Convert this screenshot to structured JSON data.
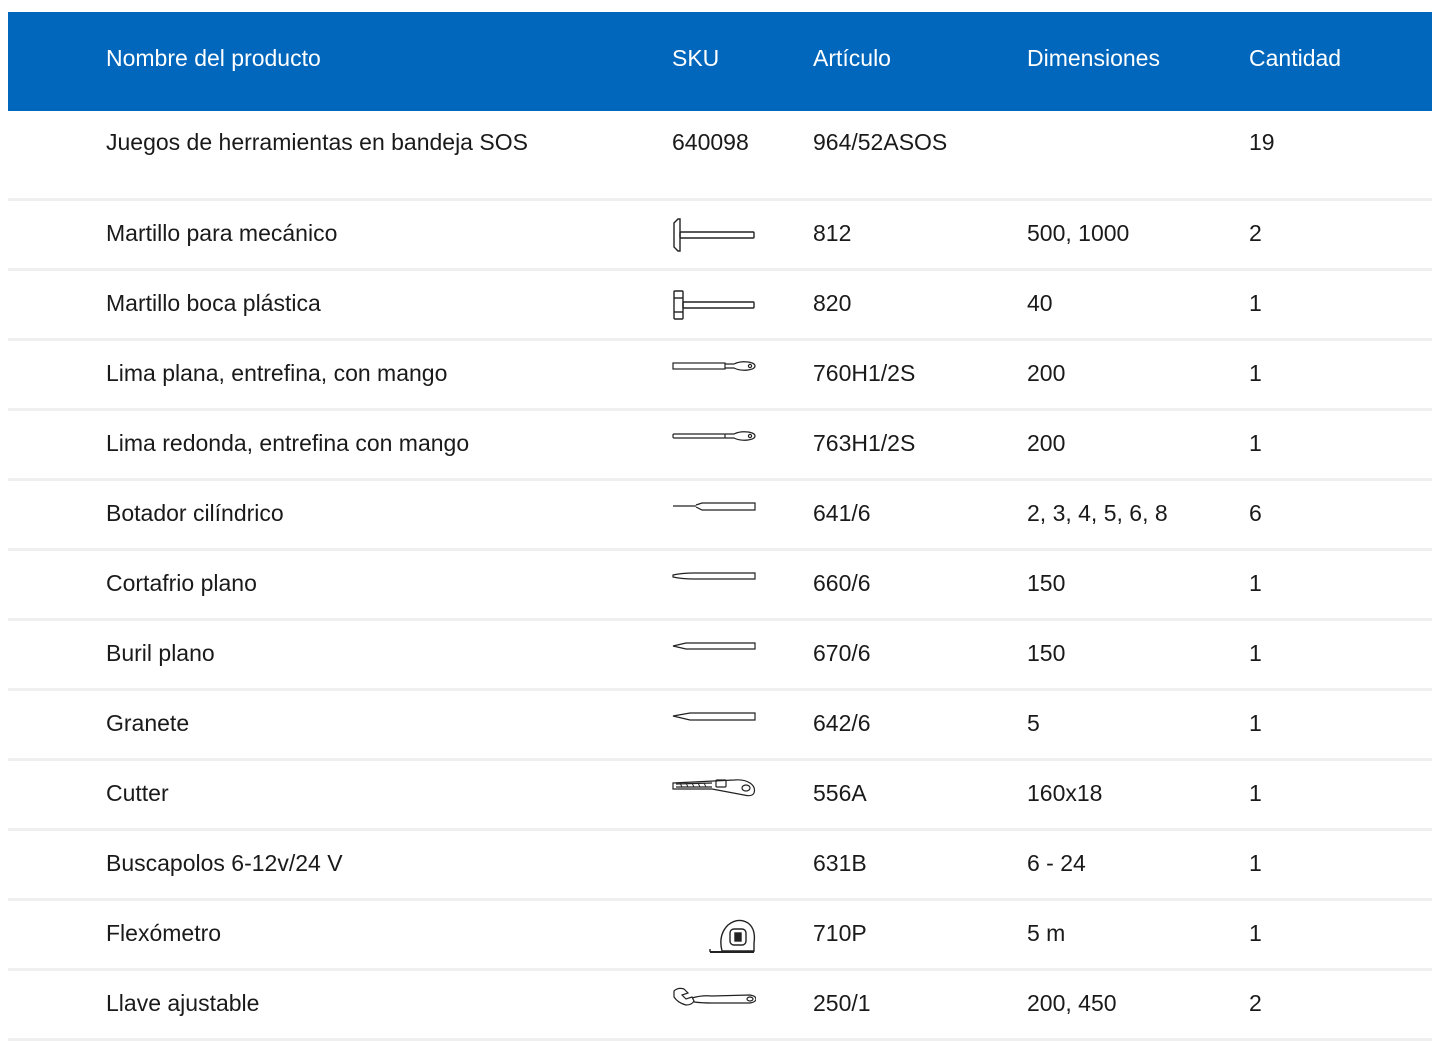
{
  "table": {
    "headers": {
      "name": "Nombre del producto",
      "sku": "SKU",
      "article": "Artículo",
      "dimensions": "Dimensiones",
      "quantity": "Cantidad"
    },
    "rows": [
      {
        "name": "Juegos de herramientas en bandeja SOS",
        "sku": "640098",
        "icon": null,
        "article": "964/52ASOS",
        "dimensions": "",
        "quantity": "19"
      },
      {
        "name": "Martillo para mecánico",
        "sku": "",
        "icon": "machinist-hammer-icon",
        "article": "812",
        "dimensions": "500, 1000",
        "quantity": "2"
      },
      {
        "name": "Martillo boca plástica",
        "sku": "",
        "icon": "plastic-mallet-icon",
        "article": "820",
        "dimensions": "40",
        "quantity": "1"
      },
      {
        "name": "Lima plana, entrefina, con mango",
        "sku": "",
        "icon": "flat-file-icon",
        "article": "760H1/2S",
        "dimensions": "200",
        "quantity": "1"
      },
      {
        "name": "Lima redonda, entrefina con mango",
        "sku": "",
        "icon": "round-file-icon",
        "article": "763H1/2S",
        "dimensions": "200",
        "quantity": "1"
      },
      {
        "name": "Botador cilíndrico",
        "sku": "",
        "icon": "pin-punch-icon",
        "article": "641/6",
        "dimensions": "2, 3, 4, 5, 6, 8",
        "quantity": "6"
      },
      {
        "name": "Cortafrio plano",
        "sku": "",
        "icon": "flat-chisel-icon",
        "article": "660/6",
        "dimensions": "150",
        "quantity": "1"
      },
      {
        "name": "Buril plano",
        "sku": "",
        "icon": "cape-chisel-icon",
        "article": "670/6",
        "dimensions": "150",
        "quantity": "1"
      },
      {
        "name": "Granete",
        "sku": "",
        "icon": "center-punch-icon",
        "article": "642/6",
        "dimensions": "5",
        "quantity": "1"
      },
      {
        "name": "Cutter",
        "sku": "",
        "icon": "cutter-knife-icon",
        "article": "556A",
        "dimensions": "160x18",
        "quantity": "1"
      },
      {
        "name": "Buscapolos 6-12v/24 V",
        "sku": "",
        "icon": null,
        "article": "631B",
        "dimensions": "6 - 24",
        "quantity": "1"
      },
      {
        "name": "Flexómetro",
        "sku": "",
        "icon": "tape-measure-icon",
        "article": "710P",
        "dimensions": "5 m",
        "quantity": "1"
      },
      {
        "name": "Llave ajustable",
        "sku": "",
        "icon": "adjustable-wrench-icon",
        "article": "250/1",
        "dimensions": "200, 450",
        "quantity": "2"
      }
    ]
  },
  "colors": {
    "header_bg": "#0067bd",
    "header_text": "#ffffff",
    "row_divider": "#efefef",
    "body_text": "#1a1a1a"
  }
}
